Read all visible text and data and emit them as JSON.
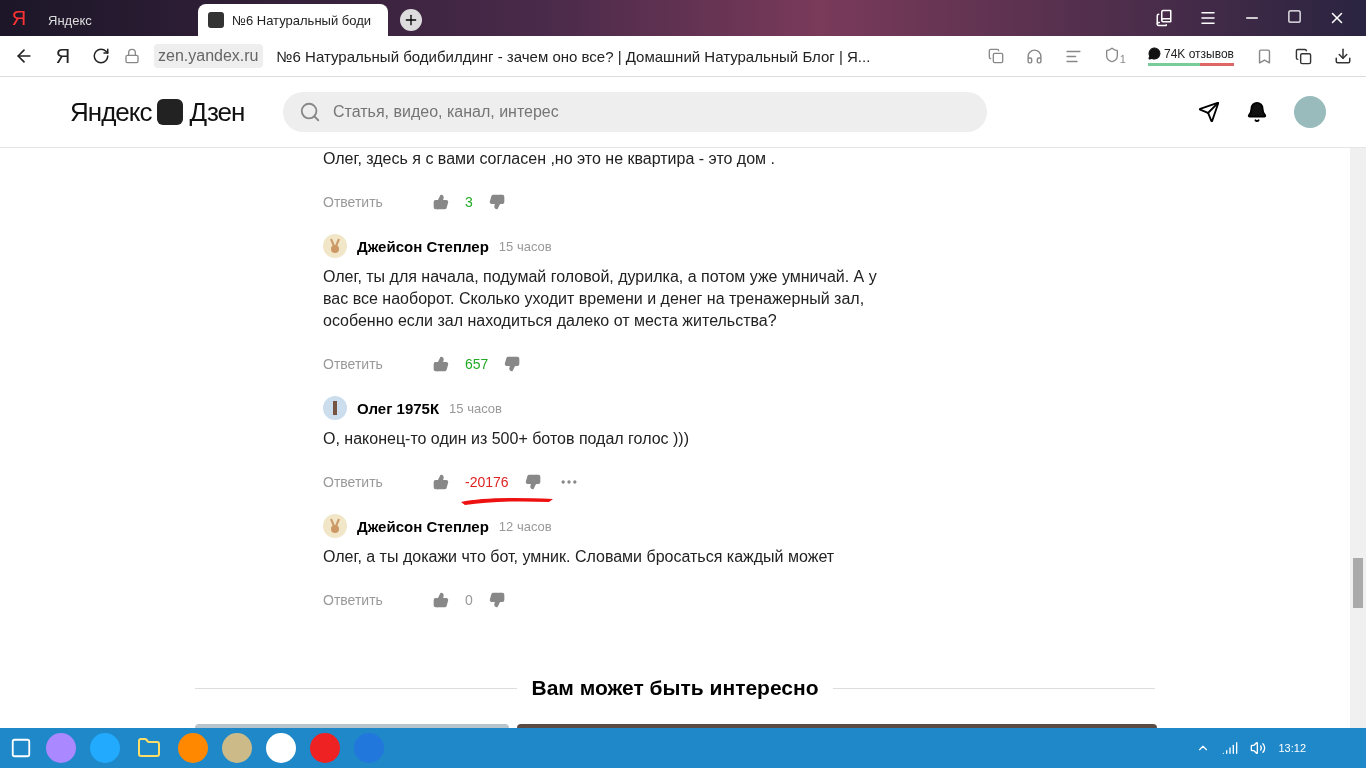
{
  "browser": {
    "logo": "Я",
    "home_button": "Я",
    "tabs": [
      {
        "title": "Яндекс",
        "selected": false
      },
      {
        "title": "№6 Натуральный боди",
        "selected": true
      }
    ],
    "url": "zen.yandex.ru",
    "page_title": "№6 Натуральный бодибилдинг - зачем оно все? | Домашний Натуральный Блог | Я...",
    "shield_count": "1",
    "reviews": "74K отзывов"
  },
  "header": {
    "logo_left": "Яндекс",
    "logo_right": "Дзен",
    "search": {
      "placeholder": "Статья, видео, канал, интерес"
    }
  },
  "comments": [
    {
      "text": "Олег, здесь я с вами согласен ,но это не квартира - это дом .",
      "reply": "Ответить",
      "score": "3",
      "color": "#22aa22",
      "menu": false,
      "underlined": false
    },
    {
      "author": "Джейсон Степлер",
      "time": "15 часов",
      "text": "Олег, ты для начала, подумай головой, дурилка, а потом уже умничай. А у вас все наоборот. Сколько уходит времени и денег на тренажерный зал, особенно если зал находиться далеко от места жительства?",
      "reply": "Ответить",
      "score": "657",
      "color": "#22aa22",
      "menu": false,
      "underlined": false,
      "avatar": {
        "kind": "bunny"
      }
    },
    {
      "author": "Олег 1975К",
      "time": "15 часов",
      "text": "О, наконец-то один из 500+ ботов подал голос )))",
      "reply": "Ответить",
      "score": "-20176",
      "color": "#dd2222",
      "menu": true,
      "underlined": true,
      "avatar": {
        "kind": "photo"
      }
    },
    {
      "author": "Джейсон Степлер",
      "time": "12 часов",
      "text": "Олег, а ты докажи что бот, умник. Словами бросаться каждый может",
      "reply": "Ответить",
      "score": "0",
      "color": "#999999",
      "menu": false,
      "underlined": false,
      "avatar": {
        "kind": "bunny"
      }
    }
  ],
  "recommend": {
    "title": "Вам может быть интересно"
  },
  "taskbar": {
    "clock": "13:12"
  }
}
